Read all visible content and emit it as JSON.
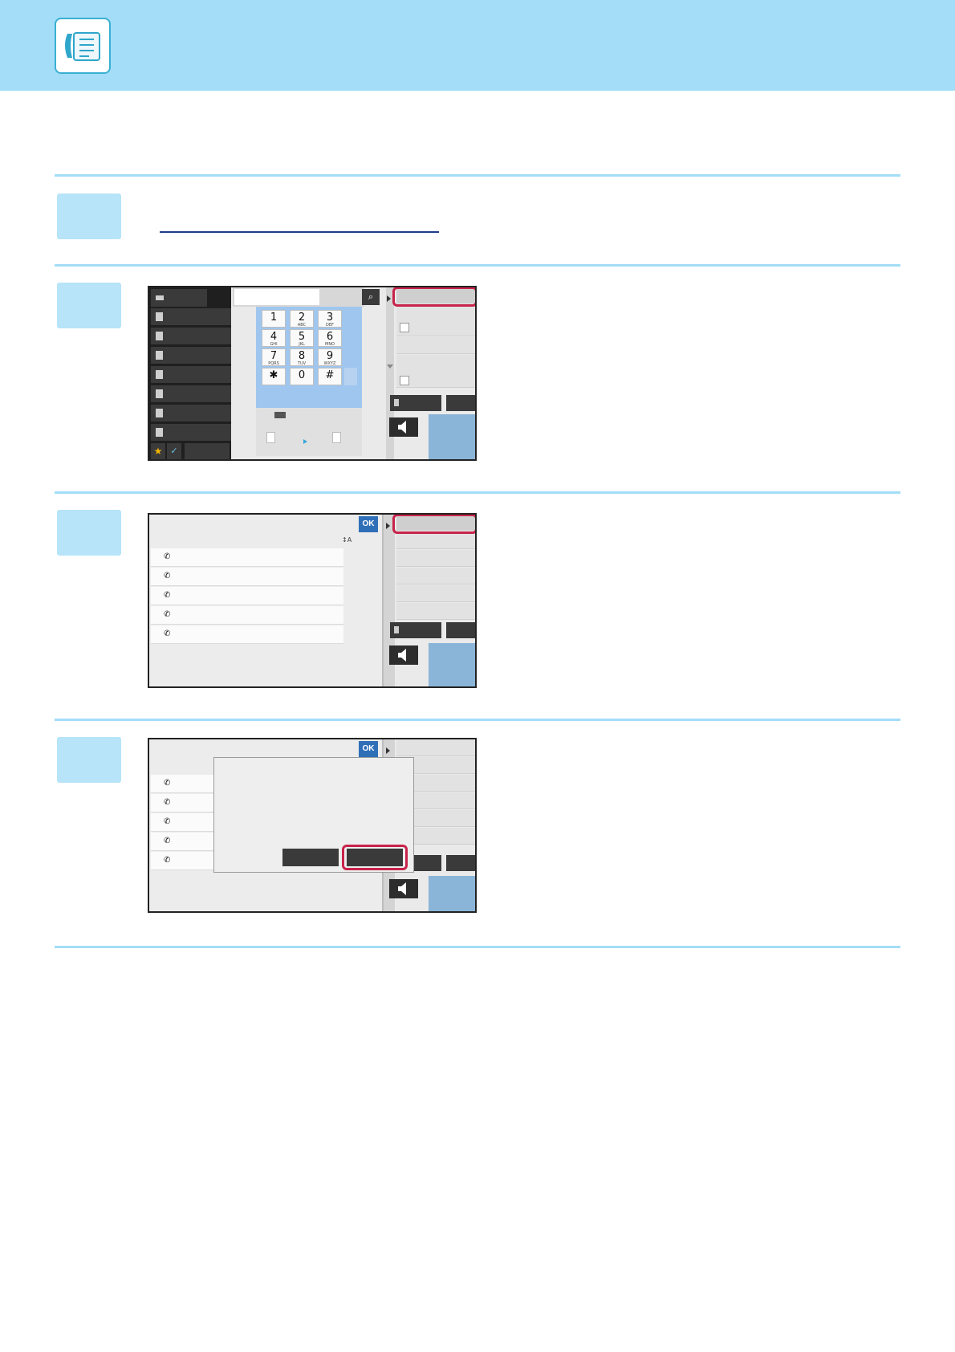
{
  "header": {
    "icon": "fax-address-book-icon",
    "band_color": "#a3ddf7"
  },
  "keypad": {
    "keys": [
      {
        "main": "1",
        "sub": ""
      },
      {
        "main": "2",
        "sub": "ABC"
      },
      {
        "main": "3",
        "sub": "DEF"
      },
      {
        "main": "4",
        "sub": "GHI"
      },
      {
        "main": "5",
        "sub": "JKL"
      },
      {
        "main": "6",
        "sub": "MNO"
      },
      {
        "main": "7",
        "sub": "PQRS"
      },
      {
        "main": "8",
        "sub": "TUV"
      },
      {
        "main": "9",
        "sub": "WXYZ"
      },
      {
        "main": "✱",
        "sub": ""
      },
      {
        "main": "0",
        "sub": ""
      },
      {
        "main": "#",
        "sub": ""
      }
    ]
  },
  "dialogs": {
    "ok_label": "OK"
  },
  "colors": {
    "highlight": "#c8234a",
    "rule": "#a3ddf7",
    "step_badge": "#b7e4f8",
    "ok_button": "#2f6fb8"
  }
}
